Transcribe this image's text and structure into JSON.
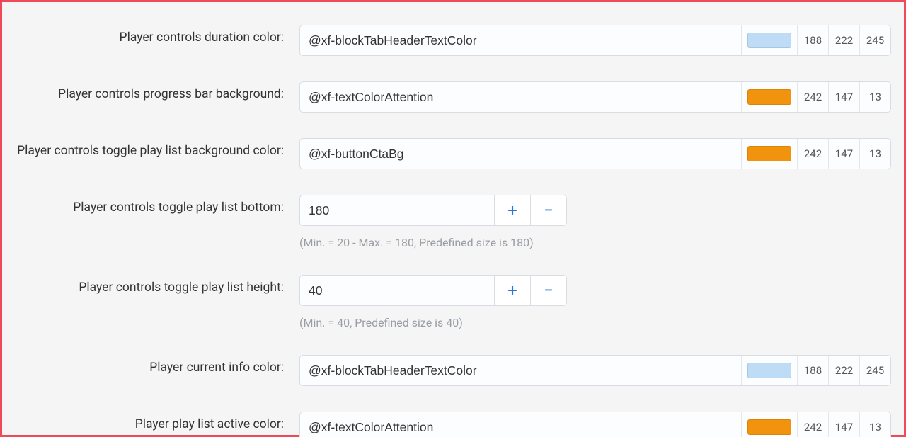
{
  "fields": [
    {
      "label": "Player controls duration color:",
      "type": "color",
      "value": "@xf-blockTabHeaderTextColor",
      "swatch": "#bedcf5",
      "r": "188",
      "g": "222",
      "b": "245"
    },
    {
      "label": "Player controls progress bar background:",
      "type": "color",
      "value": "@xf-textColorAttention",
      "swatch": "#f2930d",
      "r": "242",
      "g": "147",
      "b": "13"
    },
    {
      "label": "Player controls toggle play list background color:",
      "type": "color",
      "value": "@xf-buttonCtaBg",
      "swatch": "#f2930d",
      "r": "242",
      "g": "147",
      "b": "13"
    },
    {
      "label": "Player controls toggle play list bottom:",
      "type": "number",
      "value": "180",
      "hint": "(Min. = 20 - Max. = 180, Predefined size is 180)"
    },
    {
      "label": "Player controls toggle play list height:",
      "type": "number",
      "value": "40",
      "hint": "(Min. = 40, Predefined size is 40)"
    },
    {
      "label": "Player current info color:",
      "type": "color",
      "value": "@xf-blockTabHeaderTextColor",
      "swatch": "#bedcf5",
      "r": "188",
      "g": "222",
      "b": "245"
    },
    {
      "label": "Player play list active color:",
      "type": "color",
      "value": "@xf-textColorAttention",
      "swatch": "#f2930d",
      "r": "242",
      "g": "147",
      "b": "13"
    }
  ],
  "icons": {
    "plus": "+",
    "minus": "−"
  }
}
